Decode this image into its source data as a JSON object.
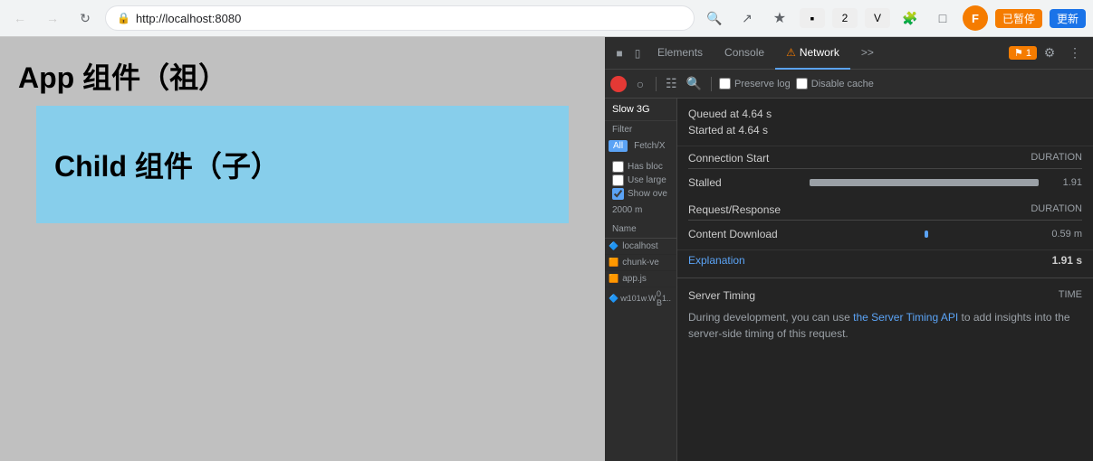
{
  "browser": {
    "url": "http://localhost:8080",
    "back_disabled": true,
    "forward_disabled": true
  },
  "browser_actions": {
    "zoom_icon": "🔍",
    "share_icon": "↗",
    "bookmark_icon": "★",
    "extension1_icon": "▪",
    "extension2_icon": "2",
    "extension3_icon": "▼",
    "extensions_icon": "🧩",
    "window_icon": "⬜",
    "profile_label": "F",
    "paused_label": "已暂停",
    "update_label": "更新"
  },
  "devtools": {
    "tabs": [
      {
        "label": "Elements",
        "icon": ""
      },
      {
        "label": "Console",
        "icon": ""
      },
      {
        "label": "Network",
        "icon": "⚠",
        "active": true
      },
      {
        "label": ">>",
        "icon": ""
      }
    ],
    "notification": "⚑ 1",
    "settings_icon": "⚙",
    "menu_icon": "⋮"
  },
  "network_toolbar": {
    "preserve_log_label": "Preserve log",
    "disable_cache_label": "Disable cache"
  },
  "network_sidebar": {
    "throttle_label": "Slow 3G",
    "filter_label": "Filter",
    "filter_tabs": [
      "All",
      "Fetch/X"
    ],
    "filter_options": [
      {
        "label": "Has bloc"
      },
      {
        "label": "Use large"
      },
      {
        "label": "Show ove",
        "checked": true
      }
    ],
    "timeline_value": "2000 m"
  },
  "name_list": {
    "header": "Name",
    "items": [
      {
        "icon": "🔷",
        "name": "localhost"
      },
      {
        "icon": "🟧",
        "name": "chunk-ve"
      },
      {
        "icon": "🟧",
        "name": "app.js"
      },
      {
        "icon": "🔷",
        "name": "ws",
        "status": "101",
        "type_label": "web...",
        "subtype": "WebSo...",
        "size": "0 B",
        "time": "1.."
      }
    ]
  },
  "timing": {
    "queued_label": "Queued at 4.64 s",
    "started_label": "Started at 4.64 s",
    "connection_start": {
      "section_label": "Connection Start",
      "duration_header": "DURATION",
      "rows": [
        {
          "label": "Stalled",
          "duration": "1.91",
          "has_bar": true
        }
      ]
    },
    "request_response": {
      "section_label": "Request/Response",
      "duration_header": "DURATION",
      "rows": [
        {
          "label": "Content Download",
          "duration": "0.59 m",
          "has_bar": true,
          "bar_type": "blue"
        }
      ]
    },
    "total_label": "1.91 s",
    "explanation_label": "Explanation",
    "server_timing": {
      "section_label": "Server Timing",
      "time_header": "TIME",
      "description": "During development, you can use ",
      "link_text": "the Server Timing API",
      "description2": " to add\ninsights into the server-side timing of this request."
    }
  },
  "webpage": {
    "app_title": "App 组件（祖）",
    "child_title": "Child 组件（子）"
  }
}
